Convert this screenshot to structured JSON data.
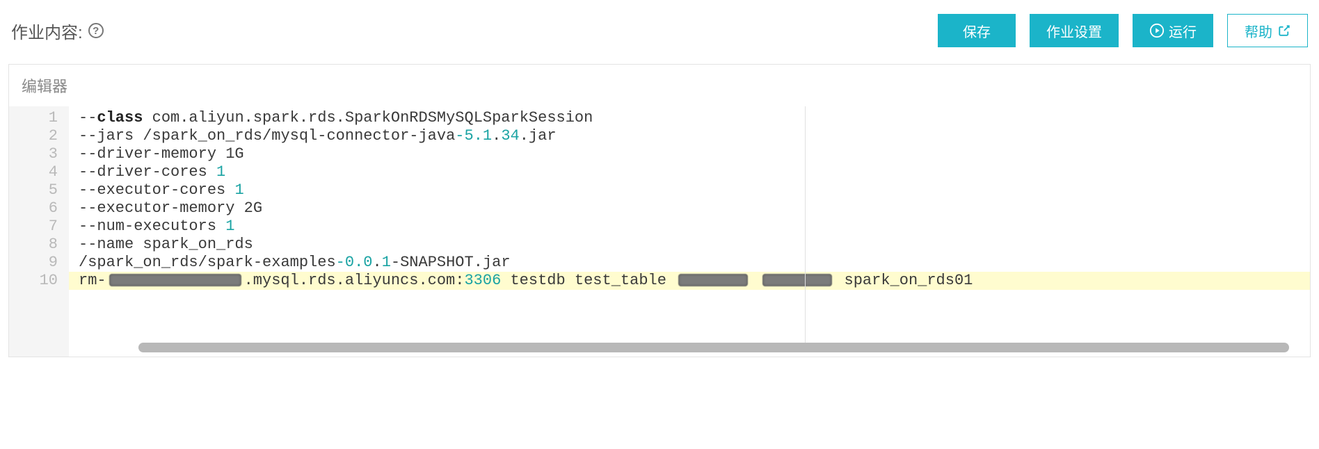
{
  "header": {
    "title": "作业内容:"
  },
  "buttons": {
    "save": "保存",
    "settings": "作业设置",
    "run": "运行",
    "help": "帮助"
  },
  "editor": {
    "label": "编辑器",
    "lines": [
      {
        "n": "1",
        "pre": "--",
        "kw": "class",
        "post": " com.aliyun.spark.rds.SparkOnRDSMySQLSparkSession"
      },
      {
        "n": "2",
        "t1": "--jars /spark_on_rds/mysql-connector-java",
        "num1": "-5.1",
        "t2": ".",
        "num2": "34",
        "t3": ".jar"
      },
      {
        "n": "3",
        "t": "--driver-memory 1G"
      },
      {
        "n": "4",
        "t1": "--driver-cores ",
        "num": "1"
      },
      {
        "n": "5",
        "t1": "--executor-cores ",
        "num": "1"
      },
      {
        "n": "6",
        "t": "--executor-memory 2G"
      },
      {
        "n": "7",
        "t1": "--num-executors ",
        "num": "1"
      },
      {
        "n": "8",
        "t": "--name spark_on_rds"
      },
      {
        "n": "9",
        "t1": "/spark_on_rds/spark-examples",
        "num1": "-0.0",
        "t2": ".",
        "num2": "1",
        "t3": "-SNAPSHOT.jar"
      },
      {
        "n": "10",
        "a": "rm-",
        "b": ".mysql.rds.aliyuncs.com:",
        "port": "3306",
        "c": " testdb test_table ",
        "d": " spark_on_rds01"
      }
    ]
  }
}
